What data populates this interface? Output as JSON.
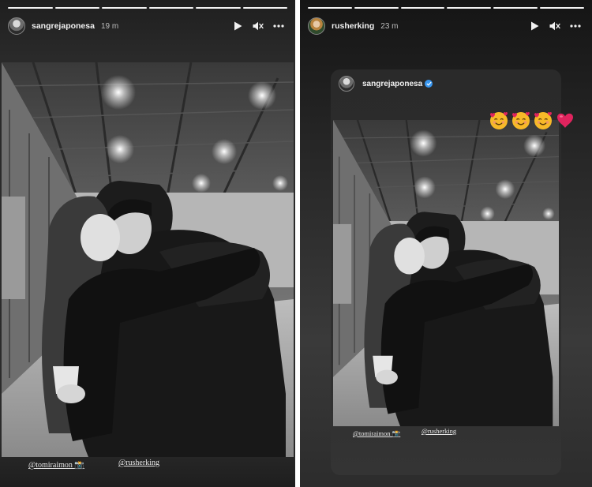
{
  "left_story": {
    "progress_segments": 6,
    "progress_active_index": 5,
    "author": {
      "username": "sangrejaponesa",
      "time": "19 m",
      "avatar_icon": "avatar-icon"
    },
    "controls": [
      "play-icon",
      "mute-icon",
      "more-options-icon"
    ],
    "mentions": [
      "@tomiraimon 📸",
      "@rusherking"
    ]
  },
  "right_story": {
    "progress_segments": 6,
    "progress_active_index": 5,
    "author": {
      "username": "rusherking",
      "time": "23 m",
      "avatar_icon": "avatar-icon"
    },
    "controls": [
      "play-icon",
      "mute-icon",
      "more-options-icon"
    ],
    "reshared_post": {
      "username": "sangrejaponesa",
      "verified": true,
      "mentions": [
        "@tomiraimon 📸",
        "@rusherking"
      ]
    },
    "stickers": [
      "🥰",
      "🥰",
      "🥰",
      "❤️"
    ]
  },
  "colors": {
    "verified_blue": "#3897f0",
    "heart_red": "#e0245e",
    "emoji_yellow": "#f7b928"
  }
}
